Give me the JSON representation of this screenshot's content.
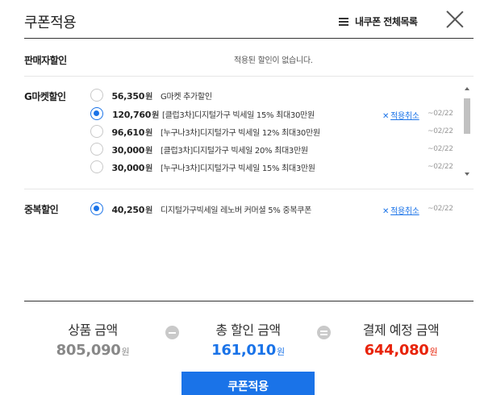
{
  "header": {
    "title": "쿠폰적용",
    "my_coupon_link": "내쿠폰 전체목록",
    "menu_icon": "hamburger-icon",
    "close_icon": "close-icon"
  },
  "seller_discount": {
    "label": "판매자할인",
    "message": "적용된 할인이 없습니다."
  },
  "gmarket_discount": {
    "label": "G마켓할인",
    "coupons": [
      {
        "amount": "56,350",
        "unit": "원",
        "name": "G마켓 추가할인",
        "selected": false,
        "cancel": "",
        "expiry": ""
      },
      {
        "amount": "120,760",
        "unit": "원",
        "name": "[클럽3차]디지털가구 빅세일 15% 최대30만원",
        "selected": true,
        "cancel": "적용취소",
        "expiry": "~02/22"
      },
      {
        "amount": "96,610",
        "unit": "원",
        "name": "[누구나3차]디지털가구 빅세일 12% 최대30만원",
        "selected": false,
        "cancel": "",
        "expiry": "~02/22"
      },
      {
        "amount": "30,000",
        "unit": "원",
        "name": "[클럽3차]디지털가구 빅세일 20% 최대3만원",
        "selected": false,
        "cancel": "",
        "expiry": "~02/22"
      },
      {
        "amount": "30,000",
        "unit": "원",
        "name": "[누구나3차]디지털가구 빅세일 15% 최대3만원",
        "selected": false,
        "cancel": "",
        "expiry": "~02/22"
      }
    ]
  },
  "duplicate_discount": {
    "label": "중복할인",
    "coupon": {
      "amount": "40,250",
      "unit": "원",
      "name": "디지털가구빅세일 레노버 커머셜 5% 중복쿠폰",
      "selected": true,
      "cancel": "적용취소",
      "expiry": "~02/22"
    }
  },
  "summary": {
    "product_label": "상품 금액",
    "product_value": "805,090",
    "discount_label": "총 할인 금액",
    "discount_value": "161,010",
    "payment_label": "결제 예정 금액",
    "payment_value": "644,080",
    "unit": "원"
  },
  "colors": {
    "accent": "#1a73e8",
    "product_value": "#888888",
    "discount_value": "#1a73e8",
    "payment_value": "#e8230a"
  },
  "apply_button": "쿠폰적용"
}
